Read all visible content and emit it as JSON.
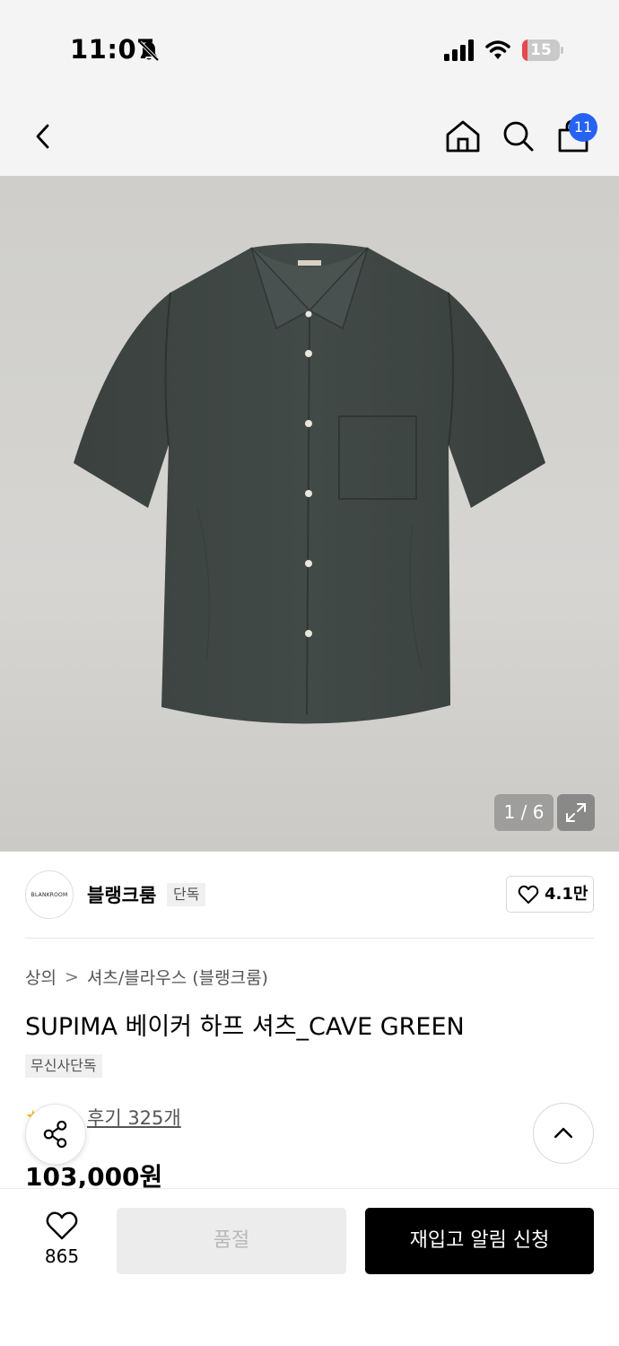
{
  "status_bar": {
    "time": "11:07",
    "battery": "15",
    "battery_level": 0.15
  },
  "nav": {
    "cart_count": "11"
  },
  "gallery": {
    "counter": "1 / 6",
    "brand_label_on_shirt": "BLANKROOM"
  },
  "brand": {
    "logo_text": "BLANKROOM",
    "name": "블랭크룸",
    "tag": "단독",
    "likes": "4.1만"
  },
  "breadcrumb": {
    "category": "상의",
    "separator": ">",
    "subcategory": "셔츠/블라우스 (블랭크룸)"
  },
  "product": {
    "title": "SUPIMA 베이커 하프 셔츠_CAVE GREEN",
    "exclusive_tag": "무신사단독",
    "rating_stars": "★",
    "review_link": "후기 325개",
    "price": "103,000원"
  },
  "bottom_bar": {
    "wish_count": "865",
    "soldout_label": "품절",
    "restock_label": "재입고 알림 신청"
  },
  "colors": {
    "accent_badge": "#2663f2",
    "shirt": "#3e4643",
    "primary_button": "#000000",
    "disabled_button": "#ececec"
  }
}
